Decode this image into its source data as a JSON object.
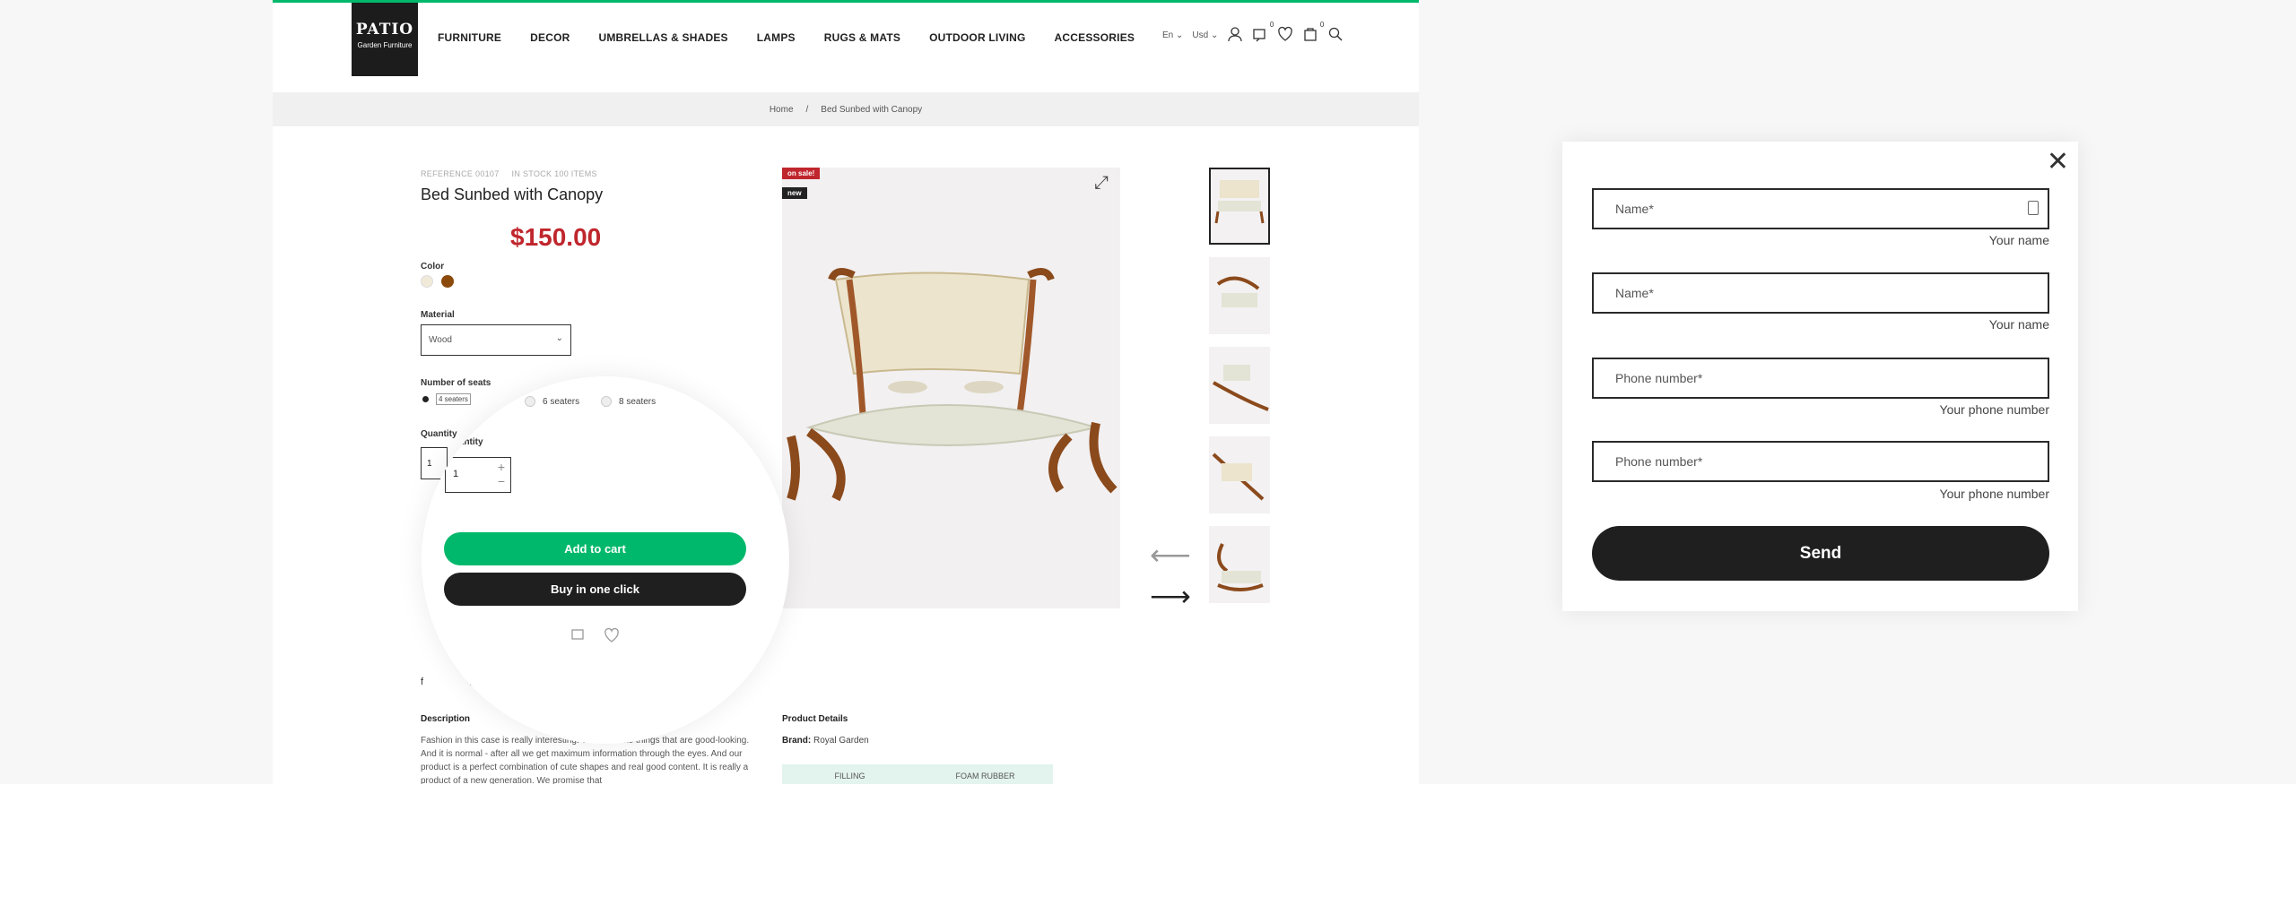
{
  "logo": {
    "name": "PATIO",
    "tagline": "Garden Furniture"
  },
  "nav": [
    "FURNITURE",
    "DECOR",
    "UMBRELLAS & SHADES",
    "LAMPS",
    "RUGS & MATS",
    "OUTDOOR LIVING",
    "ACCESSORIES"
  ],
  "header": {
    "language": "En",
    "currency": "Usd",
    "compare_count": "0",
    "cart_count": "0"
  },
  "breadcrumb": {
    "home": "Home",
    "sep": "/",
    "current": "Bed Sunbed with Canopy"
  },
  "product": {
    "reference": "REFERENCE 00107",
    "stock": "IN STOCK 100 ITEMS",
    "title": "Bed Sunbed with Canopy",
    "price": "$150.00",
    "color_label": "Color",
    "colors": [
      "#f1ead9",
      "#8b4a0c"
    ],
    "material_label": "Material",
    "material_value": "Wood",
    "seats_label": "Number of seats",
    "seats": [
      "4 seaters",
      "6 seaters",
      "6 seaters",
      "8 seaters"
    ],
    "quantity_label": "Quantity",
    "quantity_value": "1",
    "badge_sale": "on sale!",
    "badge_new": "new",
    "sale_color": "#c0262d"
  },
  "zoom": {
    "quantity_label": "Quantity",
    "quantity_value": "1",
    "add_to_cart": "Add to cart",
    "buy_one_click": "Buy in one click"
  },
  "description": {
    "title": "Description",
    "text": "Fashion in this case is really interesting. We often like things that are good-looking. And it is normal - after all we get maximum information through the eyes. And our product is a perfect combination of cute shapes and real good content. It is really a product of a new generation. We promise that"
  },
  "details": {
    "title": "Product Details",
    "brand_label": "Brand:",
    "brand_value": "Royal Garden",
    "spec_key": "FILLING",
    "spec_value": "FOAM RUBBER"
  },
  "popup": {
    "fields": [
      {
        "placeholder": "Name*",
        "hint": "Your name"
      },
      {
        "placeholder": "Name*",
        "hint": "Your name"
      },
      {
        "placeholder": "Phone number*",
        "hint": "Your phone number"
      },
      {
        "placeholder": "Phone number*",
        "hint": "Your phone number"
      }
    ],
    "send": "Send"
  },
  "colors": {
    "accent": "#00b86b",
    "dark": "#1f1f1f",
    "price": "#c0262d"
  }
}
